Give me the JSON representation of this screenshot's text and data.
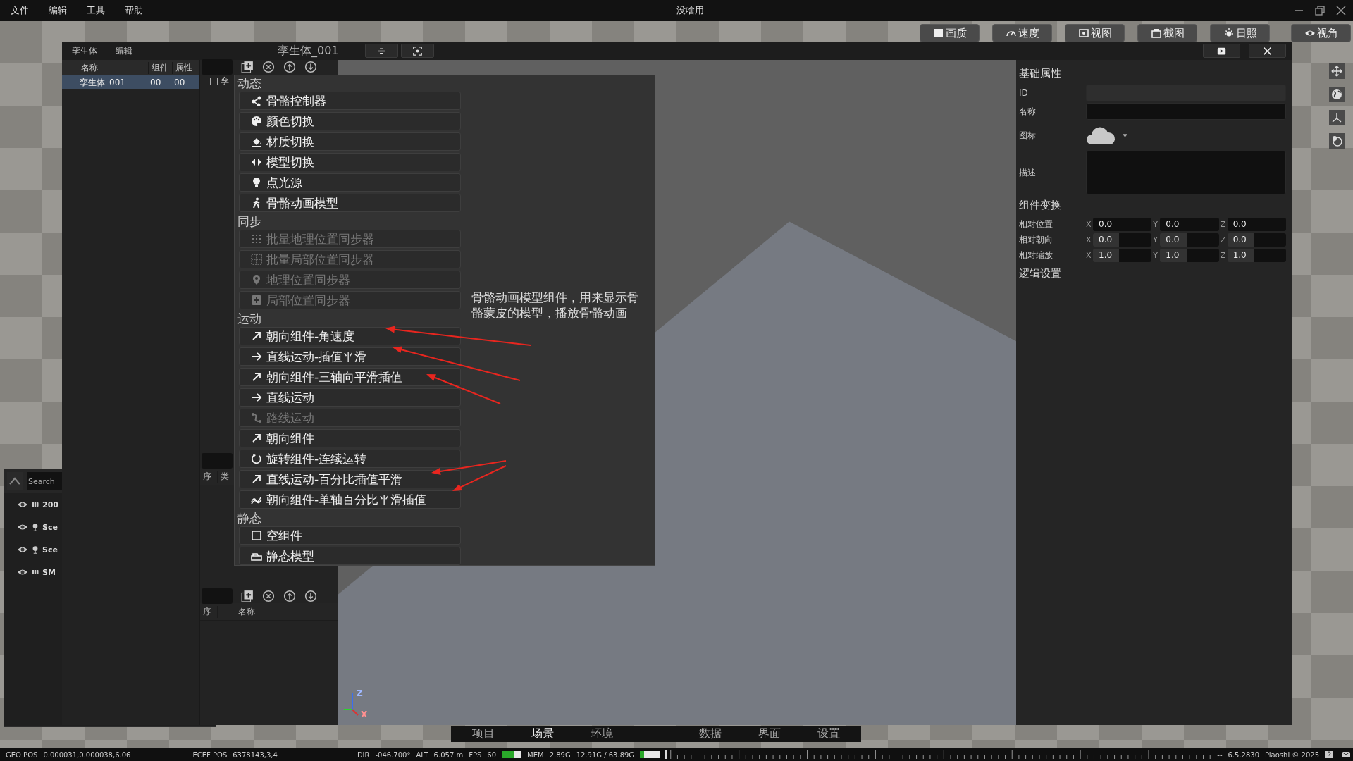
{
  "menu_bar": {
    "items": [
      "文件",
      "编辑",
      "工具",
      "帮助"
    ],
    "title": "没啥用"
  },
  "view_toolbar": [
    {
      "label": "画质",
      "kind": "image"
    },
    {
      "label": "速度",
      "kind": "gauge"
    },
    {
      "label": "视图",
      "kind": "frame"
    },
    {
      "label": "截图",
      "kind": "camera"
    },
    {
      "label": "日照",
      "kind": "sun"
    },
    {
      "label": "视角",
      "kind": "eye"
    }
  ],
  "side_tools": [
    {
      "kind": "move"
    },
    {
      "kind": "globe"
    },
    {
      "kind": "axes"
    },
    {
      "kind": "globe-pin"
    }
  ],
  "scene_panel": {
    "search": {
      "placeholder": "Search"
    },
    "items": [
      {
        "label": "200",
        "kind": "mesh"
      },
      {
        "label": "Sce",
        "kind": "light"
      },
      {
        "label": "Sce",
        "kind": "light"
      },
      {
        "label": "SM",
        "kind": "mesh"
      }
    ]
  },
  "dialog": {
    "menu": [
      "孪生体",
      "编辑"
    ],
    "title": "孪生体_001"
  },
  "entity_list": {
    "columns": [
      "名称",
      "组件",
      "属性"
    ],
    "rows": [
      {
        "cells": [
          "孪生体_001",
          "00",
          "00"
        ],
        "selected": true
      }
    ]
  },
  "component_panel": {
    "rows": [
      {
        "label": "孪",
        "checked": false
      }
    ],
    "columns": [
      "序",
      "类"
    ]
  },
  "logic_panel": {
    "columns": [
      "序",
      "名称"
    ]
  },
  "add_menu": {
    "sections": [
      {
        "title": "动态",
        "items": [
          {
            "label": "骨骼控制器",
            "kind": "nodes",
            "disabled": false
          },
          {
            "label": "颜色切换",
            "kind": "palette",
            "disabled": false
          },
          {
            "label": "材质切换",
            "kind": "bucket",
            "disabled": false
          },
          {
            "label": "模型切换",
            "kind": "code",
            "disabled": false
          },
          {
            "label": "点光源",
            "kind": "bulb",
            "disabled": false
          },
          {
            "label": "骨骼动画模型",
            "kind": "walker",
            "disabled": false
          }
        ]
      },
      {
        "title": "同步",
        "items": [
          {
            "label": "批量地理位置同步器",
            "kind": "grid",
            "disabled": true
          },
          {
            "label": "批量局部位置同步器",
            "kind": "grid-cross",
            "disabled": true
          },
          {
            "label": "地理位置同步器",
            "kind": "pin",
            "disabled": true
          },
          {
            "label": "局部位置同步器",
            "kind": "plus-square",
            "disabled": true
          }
        ]
      },
      {
        "title": "运动",
        "items": [
          {
            "label": "朝向组件-角速度",
            "kind": "arrow-diag",
            "disabled": false
          },
          {
            "label": "直线运动-插值平滑",
            "kind": "arrow-right",
            "disabled": false
          },
          {
            "label": "朝向组件-三轴向平滑插值",
            "kind": "arrow-diag",
            "disabled": false
          },
          {
            "label": "直线运动",
            "kind": "arrow-right",
            "disabled": false
          },
          {
            "label": "路线运动",
            "kind": "route",
            "disabled": true
          },
          {
            "label": "朝向组件",
            "kind": "arrow-diag",
            "disabled": false
          },
          {
            "label": "旋转组件-连续运转",
            "kind": "rotate",
            "disabled": false
          },
          {
            "label": "直线运动-百分比插值平滑",
            "kind": "arrow-diag",
            "disabled": false
          },
          {
            "label": "朝向组件-单轴百分比平滑插值",
            "kind": "wave",
            "disabled": false
          }
        ]
      },
      {
        "title": "静态",
        "items": [
          {
            "label": "空组件",
            "kind": "square",
            "disabled": false
          },
          {
            "label": "静态模型",
            "kind": "box",
            "disabled": false
          }
        ]
      }
    ]
  },
  "tooltip": "骨骼动画模型组件，用来显示骨骼蒙皮的模型，播放骨骼动画",
  "properties": {
    "basic_title": "基础属性",
    "fields": [
      {
        "label": "ID",
        "kind": "readonly"
      },
      {
        "label": "名称",
        "kind": "input"
      },
      {
        "label": "图标",
        "kind": "icon-picker"
      },
      {
        "label": "描述",
        "kind": "textarea"
      }
    ],
    "transform_title": "组件变换",
    "transform_rows": [
      {
        "label": "相对位置",
        "kind": "input",
        "values": [
          {
            "axis": "X",
            "value": "0.0"
          },
          {
            "axis": "Y",
            "value": "0.0"
          },
          {
            "axis": "Z",
            "value": "0.0"
          }
        ]
      },
      {
        "label": "相对朝向",
        "kind": "drag",
        "values": [
          {
            "axis": "X",
            "value": "0.0"
          },
          {
            "axis": "Y",
            "value": "0.0"
          },
          {
            "axis": "Z",
            "value": "0.0"
          }
        ]
      },
      {
        "label": "相对缩放",
        "kind": "drag",
        "values": [
          {
            "axis": "X",
            "value": "1.0"
          },
          {
            "axis": "Y",
            "value": "1.0"
          },
          {
            "axis": "Z",
            "value": "1.0"
          }
        ]
      }
    ],
    "logic_title": "逻辑设置"
  },
  "viewport": {
    "axis_labels": [
      "Z",
      "X"
    ]
  },
  "bottom_tabs": [
    {
      "label": "项目",
      "selected": false
    },
    {
      "label": "场景",
      "selected": true
    },
    {
      "label": "环境",
      "selected": false
    },
    {
      "label": "数据",
      "selected": false
    },
    {
      "label": "界面",
      "selected": false
    },
    {
      "label": "设置",
      "selected": false
    }
  ],
  "status_bar": {
    "geo_label": "GEO POS",
    "geo": "0.000031,0.000038,6.06",
    "ecef_label": "ECEF POS",
    "ecef": "6378143,3,4",
    "dir_label": "DIR",
    "dir": "-046.700°",
    "alt_label": "ALT",
    "alt": "6.057 m",
    "fps_label": "FPS",
    "fps": "60",
    "fps_meter": {
      "level": 0.6
    },
    "mem_label": "MEM",
    "mem": "2.89G",
    "mem_total": "12.91G / 63.89G",
    "mem_meter": {
      "level": 0.2
    },
    "dashes": "--",
    "version": "6.5.2830",
    "copyright": "Piaoshi © 2025"
  }
}
